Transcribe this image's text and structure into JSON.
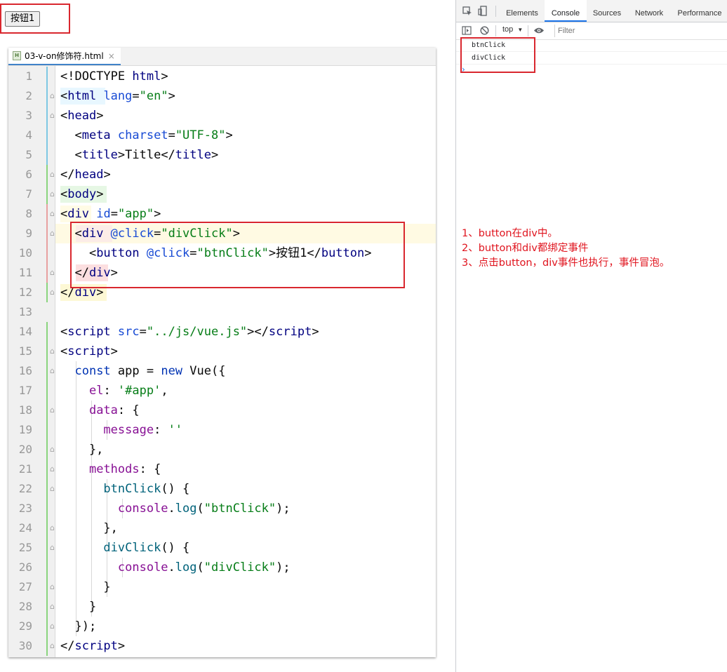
{
  "page": {
    "button_label": "按钮1"
  },
  "ide": {
    "tab_label": "03-v-on修饰符.html",
    "tab_close": "×",
    "file_icon": "H",
    "line_numbers": [
      "1",
      "2",
      "3",
      "4",
      "5",
      "6",
      "7",
      "8",
      "9",
      "10",
      "11",
      "12",
      "13",
      "14",
      "15",
      "16",
      "17",
      "18",
      "19",
      "20",
      "21",
      "22",
      "23",
      "24",
      "25",
      "26",
      "27",
      "28",
      "29",
      "30"
    ],
    "code": [
      [
        [
          "t-plain",
          "<!DOCTYPE "
        ],
        [
          "t-tag",
          "html"
        ],
        [
          "t-plain",
          ">"
        ]
      ],
      [
        [
          "t-plain",
          "<"
        ],
        [
          "t-tag",
          "html "
        ],
        [
          "t-attr",
          "lang"
        ],
        [
          "t-plain",
          "="
        ],
        [
          "t-val",
          "\"en\""
        ],
        [
          "t-plain",
          ">"
        ]
      ],
      [
        [
          "t-plain",
          "<"
        ],
        [
          "t-tag",
          "head"
        ],
        [
          "t-plain",
          ">"
        ]
      ],
      [
        [
          "t-plain",
          "  <"
        ],
        [
          "t-tag",
          "meta "
        ],
        [
          "t-attr",
          "charset"
        ],
        [
          "t-plain",
          "="
        ],
        [
          "t-val",
          "\"UTF-8\""
        ],
        [
          "t-plain",
          ">"
        ]
      ],
      [
        [
          "t-plain",
          "  <"
        ],
        [
          "t-tag",
          "title"
        ],
        [
          "t-plain",
          ">Title</"
        ],
        [
          "t-tag",
          "title"
        ],
        [
          "t-plain",
          ">"
        ]
      ],
      [
        [
          "t-plain",
          "</"
        ],
        [
          "t-tag",
          "head"
        ],
        [
          "t-plain",
          ">"
        ]
      ],
      [
        [
          "t-plain",
          "<"
        ],
        [
          "t-tag",
          "body"
        ],
        [
          "t-plain",
          ">"
        ]
      ],
      [
        [
          "t-plain",
          "<"
        ],
        [
          "t-tag",
          "div "
        ],
        [
          "t-attr",
          "id"
        ],
        [
          "t-plain",
          "="
        ],
        [
          "t-val",
          "\"app\""
        ],
        [
          "t-plain",
          ">"
        ]
      ],
      [
        [
          "t-plain",
          "  <"
        ],
        [
          "t-tag",
          "div "
        ],
        [
          "t-attr",
          "@click"
        ],
        [
          "t-plain",
          "="
        ],
        [
          "t-val",
          "\"divClick\""
        ],
        [
          "t-plain",
          ">"
        ]
      ],
      [
        [
          "t-plain",
          "    <"
        ],
        [
          "t-tag",
          "button "
        ],
        [
          "t-attr",
          "@click"
        ],
        [
          "t-plain",
          "="
        ],
        [
          "t-val",
          "\"btnClick\""
        ],
        [
          "t-plain",
          ">按钮1</"
        ],
        [
          "t-tag",
          "button"
        ],
        [
          "t-plain",
          ">"
        ]
      ],
      [
        [
          "t-plain",
          "  </"
        ],
        [
          "t-tag",
          "div"
        ],
        [
          "t-plain",
          ">"
        ]
      ],
      [
        [
          "t-plain",
          "</"
        ],
        [
          "t-tag",
          "div"
        ],
        [
          "t-plain",
          ">"
        ]
      ],
      [],
      [
        [
          "t-plain",
          "<"
        ],
        [
          "t-tag",
          "script "
        ],
        [
          "t-attr",
          "src"
        ],
        [
          "t-plain",
          "="
        ],
        [
          "t-val",
          "\"../js/vue.js\""
        ],
        [
          "t-plain",
          "></"
        ],
        [
          "t-tag",
          "script"
        ],
        [
          "t-plain",
          ">"
        ]
      ],
      [
        [
          "t-plain",
          "<"
        ],
        [
          "t-tag",
          "script"
        ],
        [
          "t-plain",
          ">"
        ]
      ],
      [
        [
          "t-plain",
          "  "
        ],
        [
          "t-kw",
          "const "
        ],
        [
          "t-plain",
          "app = "
        ],
        [
          "t-kw",
          "new "
        ],
        [
          "t-plain",
          "Vue({"
        ]
      ],
      [
        [
          "t-plain",
          "    "
        ],
        [
          "t-prop",
          "el"
        ],
        [
          "t-plain",
          ": "
        ],
        [
          "t-str",
          "'#app'"
        ],
        [
          "t-plain",
          ","
        ]
      ],
      [
        [
          "t-plain",
          "    "
        ],
        [
          "t-prop",
          "data"
        ],
        [
          "t-plain",
          ": {"
        ]
      ],
      [
        [
          "t-plain",
          "      "
        ],
        [
          "t-prop",
          "message"
        ],
        [
          "t-plain",
          ": "
        ],
        [
          "t-str",
          "''"
        ]
      ],
      [
        [
          "t-plain",
          "    },"
        ]
      ],
      [
        [
          "t-plain",
          "    "
        ],
        [
          "t-prop",
          "methods"
        ],
        [
          "t-plain",
          ": {"
        ]
      ],
      [
        [
          "t-plain",
          "      "
        ],
        [
          "t-fn",
          "btnClick"
        ],
        [
          "t-plain",
          "() {"
        ]
      ],
      [
        [
          "t-plain",
          "        "
        ],
        [
          "t-prop",
          "console"
        ],
        [
          "t-plain",
          "."
        ],
        [
          "t-fn",
          "log"
        ],
        [
          "t-plain",
          "("
        ],
        [
          "t-str",
          "\"btnClick\""
        ],
        [
          "t-plain",
          ");"
        ]
      ],
      [
        [
          "t-plain",
          "      },"
        ]
      ],
      [
        [
          "t-plain",
          "      "
        ],
        [
          "t-fn",
          "divClick"
        ],
        [
          "t-plain",
          "() {"
        ]
      ],
      [
        [
          "t-plain",
          "        "
        ],
        [
          "t-prop",
          "console"
        ],
        [
          "t-plain",
          "."
        ],
        [
          "t-fn",
          "log"
        ],
        [
          "t-plain",
          "("
        ],
        [
          "t-str",
          "\"divClick\""
        ],
        [
          "t-plain",
          ");"
        ]
      ],
      [
        [
          "t-plain",
          "      }"
        ]
      ],
      [
        [
          "t-plain",
          "    }"
        ]
      ],
      [
        [
          "t-plain",
          "  });"
        ]
      ],
      [
        [
          "t-plain",
          "</"
        ],
        [
          "t-tag",
          "script"
        ],
        [
          "t-plain",
          ">"
        ]
      ]
    ]
  },
  "devtools": {
    "tabs": [
      "Elements",
      "Console",
      "Sources",
      "Network",
      "Performance"
    ],
    "active_tab": "Console",
    "context": "top",
    "context_arrow": "▼",
    "filter_placeholder": "Filter",
    "logs": [
      "btnClick",
      "divClick"
    ],
    "prompt": "›",
    "icons": [
      "inspect-icon",
      "device-toolbar-icon",
      "sidebar-toggle-icon",
      "clear-console-icon",
      "eye-icon"
    ]
  },
  "notes": [
    "1、button在div中。",
    "2、button和div都绑定事件",
    "3、点击button，div事件也执行，事件冒泡。"
  ],
  "colors": {
    "annotation": "#d9272e",
    "accent": "#1a73e8"
  }
}
